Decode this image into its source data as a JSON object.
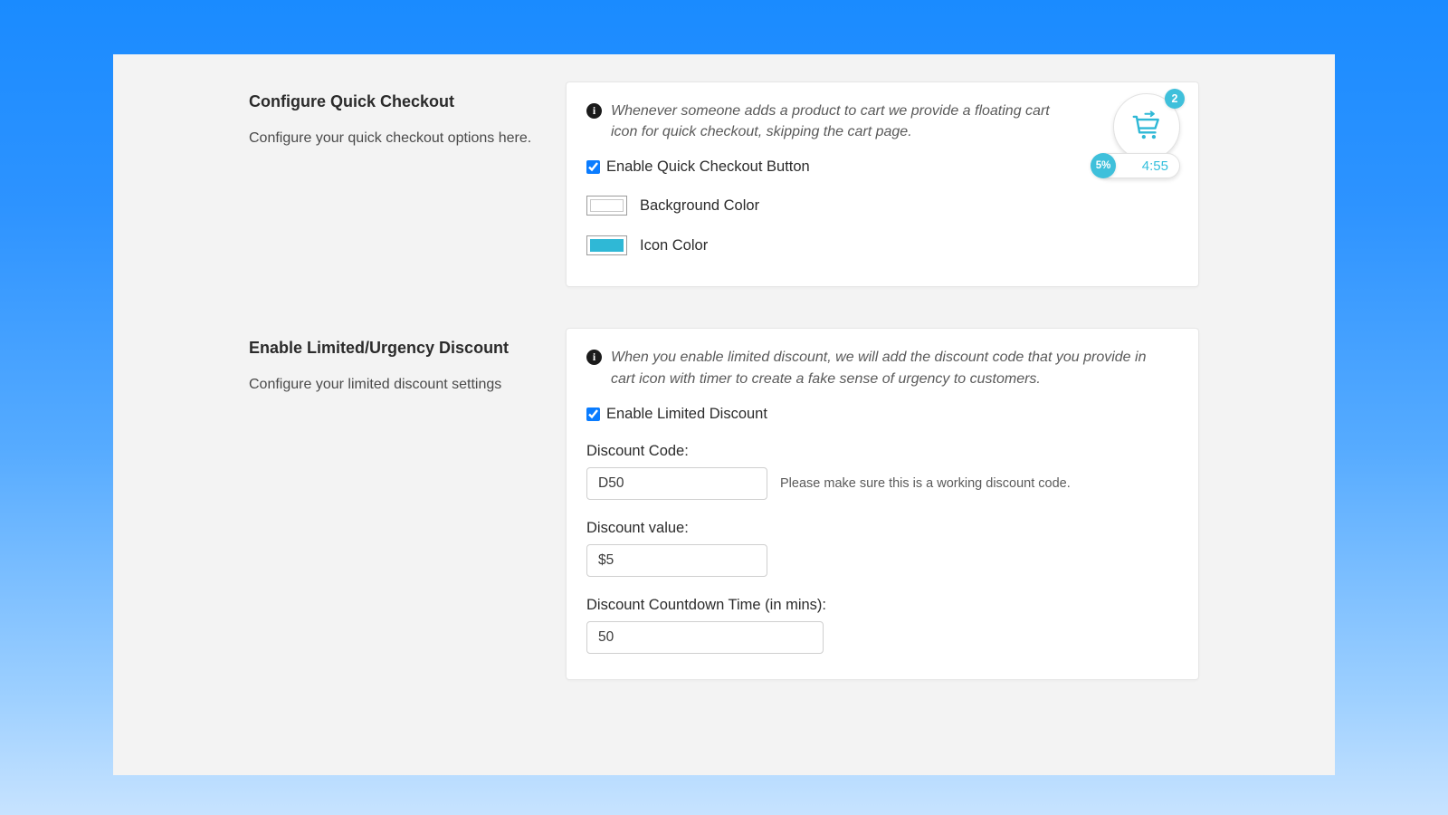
{
  "colors": {
    "background_swatch": "#ffffff",
    "icon_swatch": "#2fb8d6",
    "accent": "#0a7cff"
  },
  "quick_checkout": {
    "title": "Configure Quick Checkout",
    "subtitle": "Configure your quick checkout options here.",
    "info": "Whenever someone adds a product to cart we provide a floating cart icon for quick checkout, skipping the cart page.",
    "enable_label": "Enable Quick Checkout Button",
    "enable_checked": true,
    "bg_color_label": "Background Color",
    "icon_color_label": "Icon Color",
    "cart_preview": {
      "count": "2",
      "percent": "5%",
      "timer": "4:55"
    }
  },
  "discount": {
    "title": "Enable Limited/Urgency Discount",
    "subtitle": "Configure your limited discount settings",
    "info": "When you enable limited discount, we will add the discount code that you provide in cart icon with timer to create a fake sense of urgency to customers.",
    "enable_label": "Enable Limited Discount",
    "enable_checked": true,
    "code_label": "Discount Code:",
    "code_value": "D50",
    "code_hint": "Please make sure this is a working discount code.",
    "value_label": "Discount value:",
    "value_value": "$5",
    "countdown_label": "Discount Countdown Time (in mins):",
    "countdown_value": "50"
  }
}
